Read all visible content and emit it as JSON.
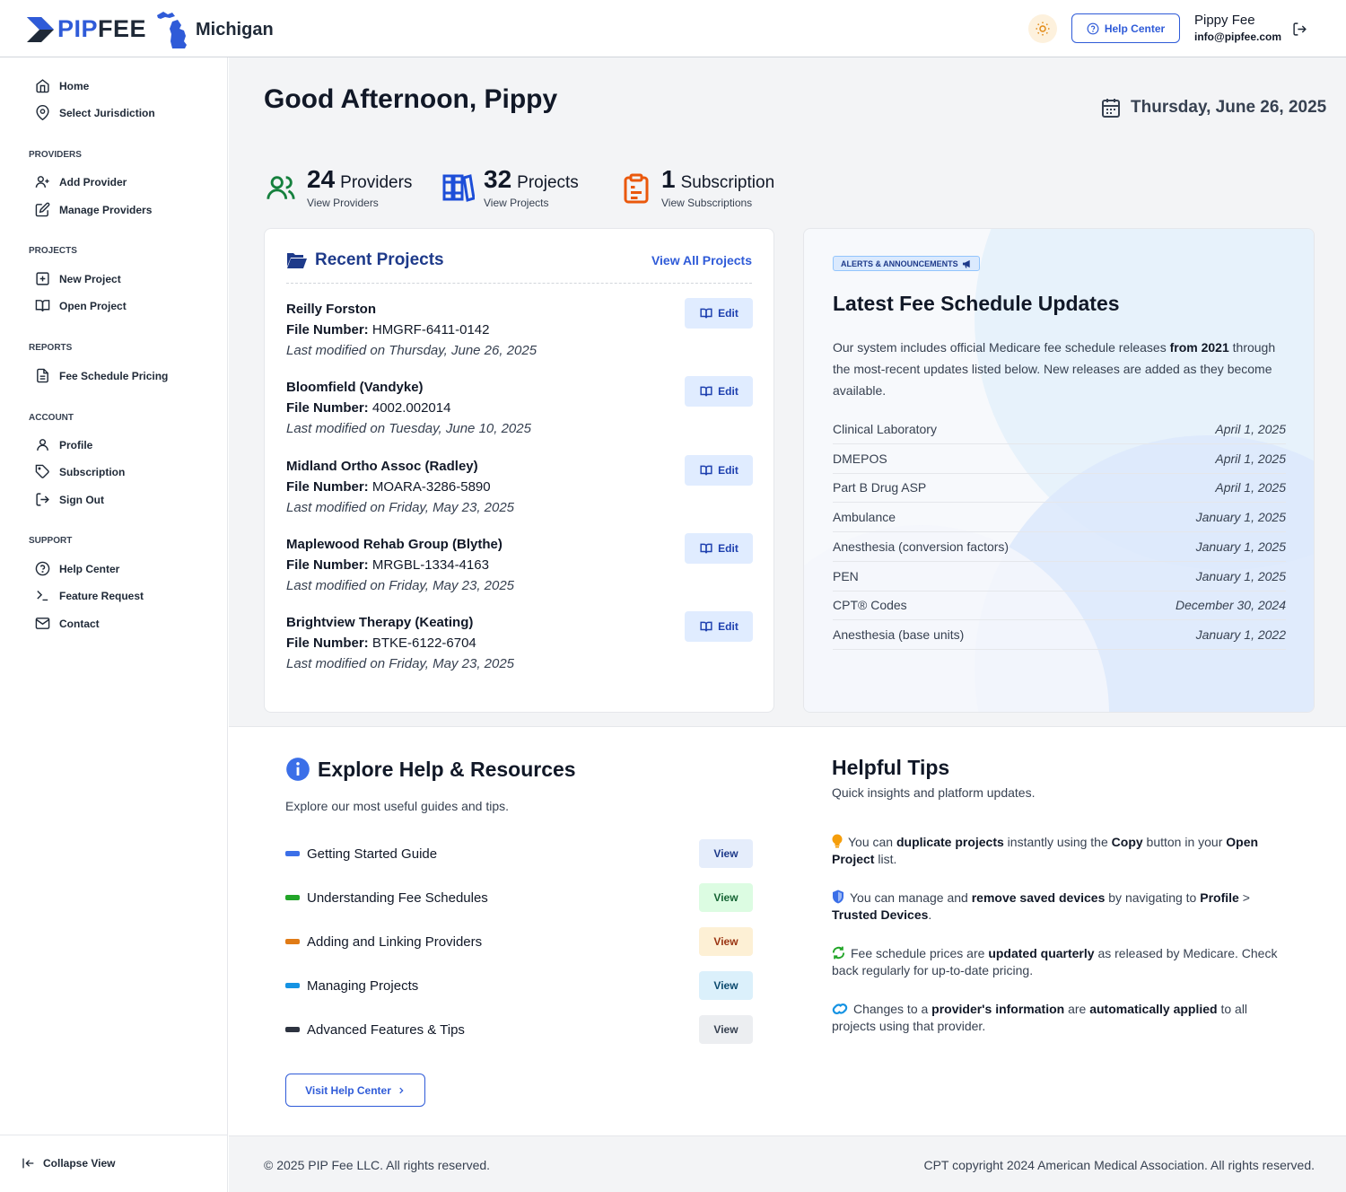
{
  "header": {
    "logo_text": "PIPFEE",
    "logo_pip": "PIP",
    "logo_fee": "FEE",
    "state": "Michigan",
    "help_center": "Help Center",
    "user_name": "Pippy Fee",
    "user_email": "info@pipfee.com"
  },
  "sidebar": {
    "top_items": [
      {
        "label": "Home",
        "icon": "home-icon"
      },
      {
        "label": "Select Jurisdiction",
        "icon": "map-pin-icon"
      }
    ],
    "groups": [
      {
        "title": "PROVIDERS",
        "items": [
          {
            "label": "Add Provider"
          },
          {
            "label": "Manage Providers"
          }
        ]
      },
      {
        "title": "PROJECTS",
        "items": [
          {
            "label": "New Project"
          },
          {
            "label": "Open Project"
          }
        ]
      },
      {
        "title": "REPORTS",
        "items": [
          {
            "label": "Fee Schedule Pricing"
          }
        ]
      },
      {
        "title": "ACCOUNT",
        "items": [
          {
            "label": "Profile"
          },
          {
            "label": "Subscription"
          },
          {
            "label": "Sign Out"
          }
        ]
      },
      {
        "title": "SUPPORT",
        "items": [
          {
            "label": "Help Center"
          },
          {
            "label": "Feature Request"
          },
          {
            "label": "Contact"
          }
        ]
      }
    ],
    "collapse": "Collapse View"
  },
  "main": {
    "greeting": "Good Afternoon, Pippy",
    "date": "Thursday, June 26, 2025",
    "stats": [
      {
        "num": "24",
        "label": "Providers",
        "sub": "View Providers",
        "color": "#15803d"
      },
      {
        "num": "32",
        "label": "Projects",
        "sub": "View Projects",
        "color": "#1d4ed8"
      },
      {
        "num": "1",
        "label": "Subscription",
        "sub": "View Subscriptions",
        "color": "#ea580c"
      }
    ],
    "recent": {
      "title": "Recent Projects",
      "view_all": "View All Projects",
      "file_label": "File Number:",
      "edit_label": "Edit",
      "projects": [
        {
          "name": "Reilly Forston",
          "file": "HMGRF-6411-0142",
          "modified": "Last modified on Thursday, June 26, 2025"
        },
        {
          "name": "Bloomfield (Vandyke)",
          "file": "4002.002014",
          "modified": "Last modified on Tuesday, June 10, 2025"
        },
        {
          "name": "Midland Ortho Assoc (Radley)",
          "file": "MOARA-3286-5890",
          "modified": "Last modified on Friday, May 23, 2025"
        },
        {
          "name": "Maplewood Rehab Group (Blythe)",
          "file": "MRGBL-1334-4163",
          "modified": "Last modified on Friday, May 23, 2025"
        },
        {
          "name": "Brightview Therapy (Keating)",
          "file": "BTKE-6122-6704",
          "modified": "Last modified on Friday, May 23, 2025"
        }
      ]
    },
    "alerts": {
      "badge": "ALERTS & ANNOUNCEMENTS",
      "title": "Latest Fee Schedule Updates",
      "desc_1": "Our system includes official Medicare fee schedule releases ",
      "desc_bold": "from 2021",
      "desc_2": " through the most-recent updates listed below. New releases are added as they become available.",
      "updates": [
        {
          "name": "Clinical Laboratory",
          "date": "April 1, 2025"
        },
        {
          "name": "DMEPOS",
          "date": "April 1, 2025"
        },
        {
          "name": "Part B Drug ASP",
          "date": "April 1, 2025"
        },
        {
          "name": "Ambulance",
          "date": "January 1, 2025"
        },
        {
          "name": "Anesthesia (conversion factors)",
          "date": "January 1, 2025"
        },
        {
          "name": "PEN",
          "date": "January 1, 2025"
        },
        {
          "name": "CPT® Codes",
          "date": "December 30, 2024"
        },
        {
          "name": "Anesthesia (base units)",
          "date": "January 1, 2022"
        }
      ]
    }
  },
  "help": {
    "title": "Explore Help & Resources",
    "subtitle": "Explore our most useful guides and tips.",
    "view_label": "View",
    "resources": [
      {
        "label": "Getting Started Guide",
        "color": "#3b6fe8",
        "btn_bg": "#e5edfb",
        "btn_fg": "#1e3a8a"
      },
      {
        "label": "Understanding Fee Schedules",
        "color": "#22a528",
        "btn_bg": "#dcfce2",
        "btn_fg": "#166534"
      },
      {
        "label": "Adding and Linking Providers",
        "color": "#e07b16",
        "btn_bg": "#fdf0d5",
        "btn_fg": "#9a3412"
      },
      {
        "label": "Managing Projects",
        "color": "#1593e3",
        "btn_bg": "#dbf0fb",
        "btn_fg": "#0c4a6e"
      },
      {
        "label": "Advanced Features & Tips",
        "color": "#2d3340",
        "btn_bg": "#eceef1",
        "btn_fg": "#374151"
      }
    ],
    "visit_button": "Visit Help Center"
  },
  "tips": {
    "title": "Helpful Tips",
    "subtitle": "Quick insights and platform updates.",
    "items": [
      {
        "icon": "lightbulb-icon",
        "t1": "You can ",
        "b1": "duplicate projects",
        "t2": " instantly using the ",
        "b2": "Copy",
        "t3": " button in your ",
        "b3": "Open Project",
        "t4": " list."
      },
      {
        "icon": "shield-icon",
        "t1": "You can manage and ",
        "b1": "remove saved devices",
        "t2": " by navigating to ",
        "b2": "Profile",
        "t3": " > ",
        "b3": "Trusted Devices",
        "t4": "."
      },
      {
        "icon": "refresh-icon",
        "t1": "Fee schedule prices are ",
        "b1": "updated quarterly",
        "t2": " as released by Medicare. Check back regularly for up-to-date pricing."
      },
      {
        "icon": "link-icon",
        "t1": "Changes to a ",
        "b1": "provider's information",
        "t2": " are ",
        "b2": "automatically applied",
        "t3": " to all projects using that provider."
      }
    ]
  },
  "footer": {
    "left": "© 2025 PIP Fee LLC. All rights reserved.",
    "right": "CPT copyright 2024 American Medical Association. All rights reserved."
  }
}
